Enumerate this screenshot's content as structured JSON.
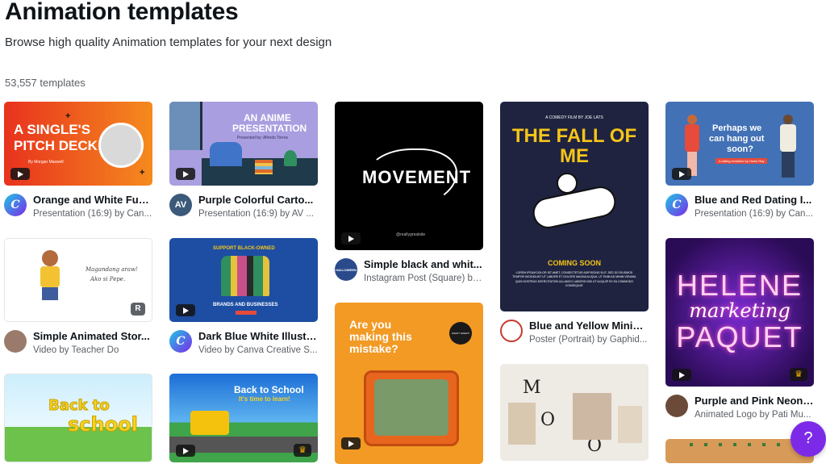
{
  "header": {
    "title": "Animation templates",
    "subtitle": "Browse high quality Animation templates for your next design",
    "count": "53,557 templates"
  },
  "cards": [
    {
      "name": "Orange and White Fun...",
      "by": "Presentation (16:9) by Can...",
      "thumb_lines": [
        "A SINGLE'S",
        "PITCH DECK"
      ],
      "thumb_small": "By Morgan Maxwell"
    },
    {
      "name": "Purple Colorful Carto...",
      "by": "Presentation (16:9) by AV ...",
      "thumb_lines": [
        "AN ANIME",
        "PRESENTATION"
      ],
      "thumb_small": "Presented by: Alfredo Torres",
      "avatar_text": "AV"
    },
    {
      "name": "Simple black and whit...",
      "by": "Instagram Post (Square) by...",
      "thumb_lines": [
        "MOVEMENT"
      ],
      "thumb_small": "@reallygreatsite",
      "avatar_text": "HALLOWEEN"
    },
    {
      "name": "Blue and Yellow Minim...",
      "by": "Poster (Portrait) by Gaphid...",
      "thumb_lines": [
        "THE FALL OF ME"
      ],
      "thumb_top": "A COMEDY FILM BY JOE LATS",
      "thumb_bottom": "COMING SOON",
      "thumb_body": "LOREM IPSUM DOLOR SIT AMET, CONSECTETUR ADIPISCING ELIT. SED DO EIUSMOD TEMPOR INCIDIDUNT UT LABORE ET DOLORE MAGNA ALIQUA. UT ENIM AD MINIM VENIAM, QUIS NOSTRUD EXERCITATION ULLAMCO LABORIS NISI UT ALIQUIP EX EA COMMODO CONSEQUAT."
    },
    {
      "name": "Blue and Red Dating I...",
      "by": "Presentation (16:9) by Can...",
      "thumb_lines": [
        "Perhaps we",
        "can hang out",
        "soon?"
      ],
      "thumb_small": "A dating invitation by Owen Ray"
    },
    {
      "name": "Simple Animated Stor...",
      "by": "Video by Teacher Do",
      "thumb_lines": [
        "Magandang araw!",
        "Ako si Pepe."
      ],
      "badge": "R"
    },
    {
      "name": "Dark Blue White Illustr...",
      "by": "Video by Canva Creative S...",
      "thumb_lines": [
        "SUPPORT BLACK-OWNED",
        "BRANDS AND BUSINESSES"
      ]
    },
    {
      "name": "Purple and Pink Neon ...",
      "by": "Animated Logo by Pati Mu...",
      "thumb_lines": [
        "HELENE",
        "PAQUET",
        "marketing"
      ]
    },
    {
      "thumb_lines": [
        "Back to",
        "school"
      ]
    },
    {
      "thumb_lines": [
        "Back to School",
        "It's time to learn!"
      ]
    },
    {
      "thumb_lines": [
        "Are you",
        "making this",
        "mistake?"
      ],
      "thumb_small": "WHAT? GREAT! NOW"
    },
    {
      "thumb_lines": [
        "M",
        "O",
        "O"
      ]
    }
  ],
  "colors": {
    "brand": "#7d2ae8",
    "help": "#7d2ae8"
  },
  "help": {
    "label": "?"
  }
}
